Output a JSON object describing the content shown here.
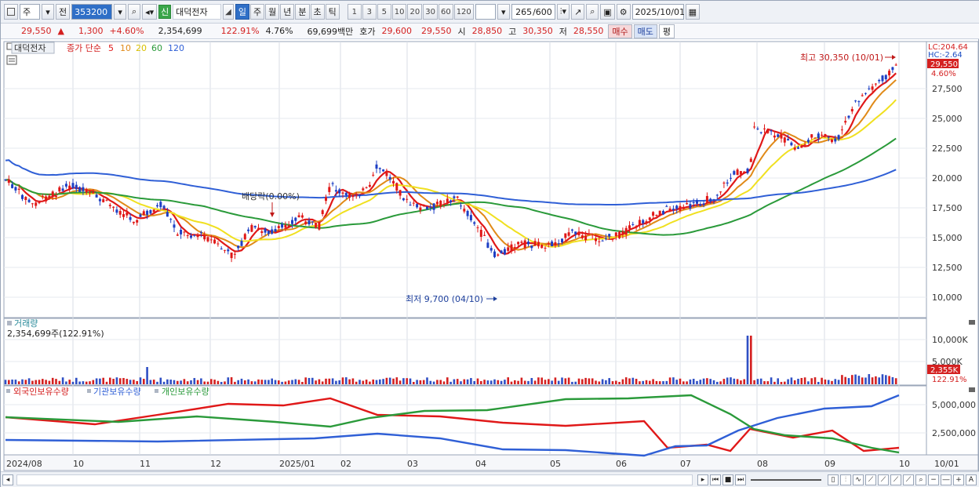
{
  "toolbar": {
    "type_label": "주",
    "prev_label": "전",
    "code_value": "353200",
    "sin_badge": "신",
    "stock_name": "대덕전자",
    "periods": [
      "일",
      "주",
      "월",
      "년",
      "분",
      "초",
      "틱"
    ],
    "active_period": "일",
    "intervals": [
      "1",
      "3",
      "5",
      "10",
      "20",
      "30",
      "60",
      "120"
    ],
    "count_value": "265",
    "count_total": "/600",
    "date_value": "2025/10/01"
  },
  "quote": {
    "price": "29,550",
    "arrow": "▲",
    "change": "1,300",
    "change_pct": "+4.60%",
    "volume": "2,354,699",
    "volume_ratio": "122.91%",
    "turnover": "4.76%",
    "amount": "69,699백만",
    "bid_label": "호가",
    "ask_price": "29,600",
    "bid_price": "29,550",
    "open_label": "시",
    "open_price": "28,850",
    "high_label": "고",
    "high_price": "30,350",
    "low_label": "저",
    "low_price": "28,550",
    "buy_label": "매수",
    "sell_label": "매도",
    "eval_label": "평"
  },
  "price_panel": {
    "name_tag": "대덕전자",
    "legend_prefix": "종가 단순",
    "ma_labels": [
      "5",
      "10",
      "20",
      "60",
      "120"
    ],
    "ma_colors": [
      "#e01818",
      "#e08a18",
      "#f0e020",
      "#2a9a3a",
      "#2f5fd6"
    ],
    "lc_label": "LC:204.64",
    "hc_label": "HC:-2.64",
    "last_price_tag": "29,550",
    "last_pct_tag": "4.60%",
    "high_annot": "최고 30,350 (10/01)",
    "low_annot": "최저 9,700 (04/10)",
    "event_annot": "배당락(0.00%)",
    "y_ticks": [
      "27,500",
      "25,000",
      "22,500",
      "20,000",
      "17,500",
      "15,000",
      "12,500",
      "10,000"
    ]
  },
  "volume_panel": {
    "title": "거래량",
    "value": "2,354,699주(122.91%)",
    "y_ticks": [
      "10,000K",
      "5,000K"
    ],
    "last_tag": "2,355K",
    "last_pct": "122.91%"
  },
  "holder_panel": {
    "legend": [
      "외국인보유수량",
      "기관보유수량",
      "개인보유수량"
    ],
    "colors": [
      "#e01818",
      "#2f5fd6",
      "#2a9a3a"
    ],
    "y_ticks": [
      "5,000,000",
      "2,500,000"
    ]
  },
  "x_axis": {
    "labels": [
      "2024/08",
      "10",
      "11",
      "12",
      "2025/01",
      "02",
      "03",
      "04",
      "05",
      "06",
      "07",
      "08",
      "09",
      "10"
    ],
    "right_label": "10/01"
  }
}
